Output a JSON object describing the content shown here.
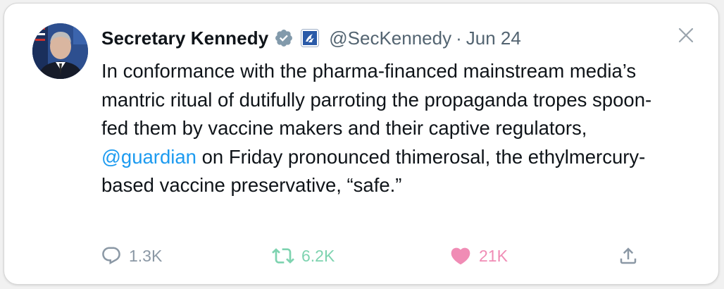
{
  "tweet": {
    "display_name": "Secretary Kennedy",
    "handle": "@SecKennedy",
    "separator": "·",
    "date": "Jun 24",
    "text_before_mention": "In conformance with the pharma-financed mainstream media’s mantric ritual of dutifully parroting the propaganda tropes spoon-fed them by vaccine makers and their captive regulators, ",
    "mention": "@guardian",
    "text_after_mention": " on Friday pronounced thimerosal, the ethylmercury-based vaccine preservative, “safe.”"
  },
  "actions": {
    "reply_count": "1.3K",
    "repost_count": "6.2K",
    "like_count": "21K"
  },
  "icons": {
    "avatar": "profile-photo",
    "verified": "verified-badge-icon",
    "affiliation": "hhs-eagle-badge-icon",
    "close": "close-icon",
    "reply": "reply-icon",
    "repost": "repost-icon",
    "like": "heart-icon",
    "share": "share-icon"
  },
  "colors": {
    "mention": "#1d9bf0",
    "reply": "#8b98a5",
    "repost": "#7ed3b0",
    "like": "#f08cb5",
    "secondary_text": "#536471",
    "verified_badge": "#829aab"
  }
}
